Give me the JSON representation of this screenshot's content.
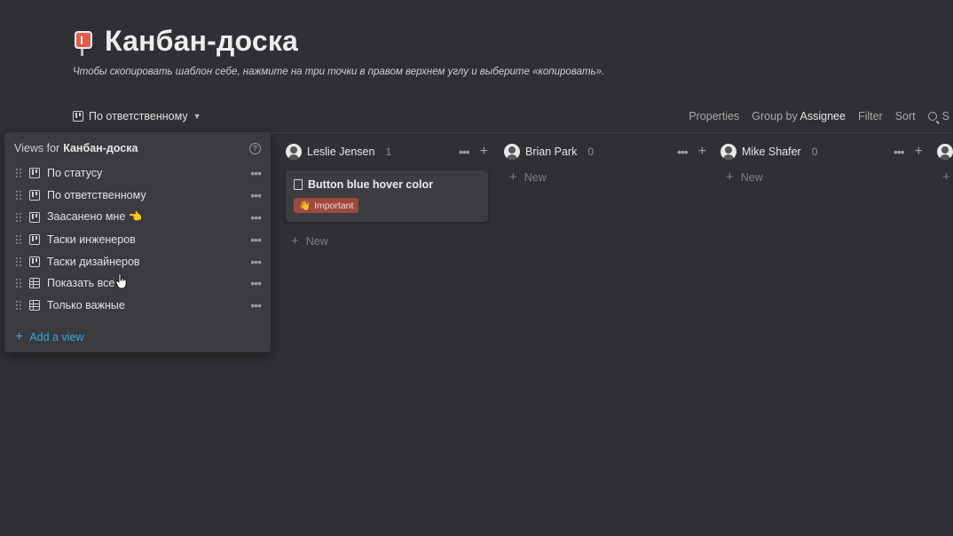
{
  "page": {
    "title": "Канбан-доска",
    "subtitle": "Чтобы скопировать шаблон себе, нажмите на три точки в правом верхнем углу и выберите «копировать».",
    "icon": "kanban-pin-icon"
  },
  "toolbar": {
    "current_view": "По ответственному",
    "properties": "Properties",
    "group_by_prefix": "Group by",
    "group_by_value": "Assignee",
    "filter": "Filter",
    "sort": "Sort",
    "search": "S"
  },
  "views_panel": {
    "title_prefix": "Views for",
    "title_db": "Канбан-доска",
    "items": [
      {
        "label": "По статусу",
        "icon": "board-icon"
      },
      {
        "label": "По ответственному",
        "icon": "board-icon"
      },
      {
        "label": "Заасанено мне 👈",
        "icon": "board-icon"
      },
      {
        "label": "Таски инженеров",
        "icon": "board-icon"
      },
      {
        "label": "Таски дизайнеров",
        "icon": "board-icon"
      },
      {
        "label": "Показать все",
        "icon": "table-icon"
      },
      {
        "label": "Только важные",
        "icon": "table-icon"
      }
    ],
    "add_view": "Add a view"
  },
  "columns": [
    {
      "name": "Leslie Jensen",
      "count": "1",
      "cards": [
        {
          "title": "Button blue hover color",
          "tag": "Important",
          "tag_emoji": "👋"
        }
      ],
      "new_label": "New"
    },
    {
      "name": "Brian Park",
      "count": "0",
      "cards": [],
      "new_label": "New"
    },
    {
      "name": "Mike Shafer",
      "count": "0",
      "cards": [],
      "new_label": "New"
    }
  ],
  "colors": {
    "background": "#2f3033",
    "panel": "#3a3b3f",
    "card": "#3c3d41",
    "tag": "#9c4a3f",
    "accent_link": "#3ba3d9"
  }
}
